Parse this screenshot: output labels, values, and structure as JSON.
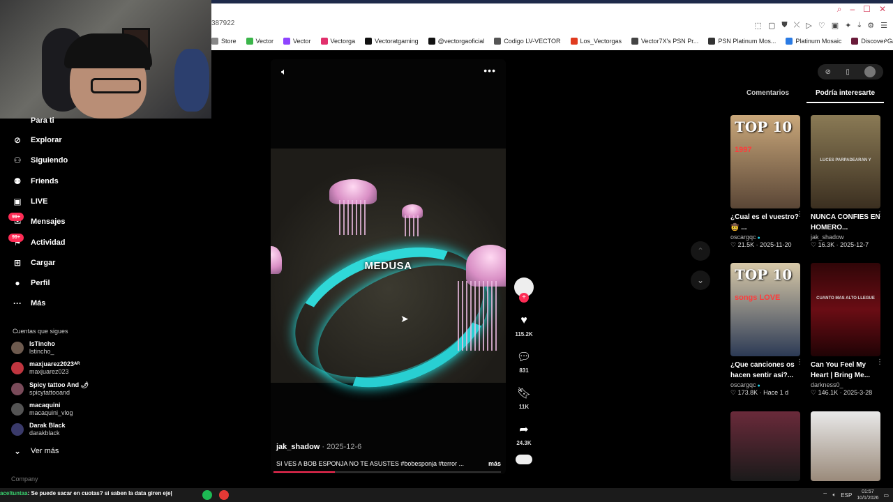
{
  "browser": {
    "address_fragment": "387922",
    "bookmarks": [
      {
        "label": "Store",
        "color": "#888888"
      },
      {
        "label": "Vector",
        "color": "#3bb54a"
      },
      {
        "label": "Vector",
        "color": "#8e44ff"
      },
      {
        "label": "Vectorga",
        "color": "#e1306c"
      },
      {
        "label": "Vectoratgaming",
        "color": "#111111"
      },
      {
        "label": "@vectorgaoficial",
        "color": "#111111"
      },
      {
        "label": "Codigo LV-VECTOR",
        "color": "#555555"
      },
      {
        "label": "Los_Vectorgas",
        "color": "#e03b1f"
      },
      {
        "label": "Vector7X's PSN Pr...",
        "color": "#444444"
      },
      {
        "label": "PSN Platinum Mos...",
        "color": "#333333"
      },
      {
        "label": "Platinum Mosaic",
        "color": "#2a7be4"
      },
      {
        "label": "Discover Games -...",
        "color": "#6a1b3a"
      }
    ]
  },
  "sidebar": {
    "top_partial": "Para ti",
    "items": [
      {
        "label": "Explorar",
        "icon": "compass-icon"
      },
      {
        "label": "Siguiendo",
        "icon": "following-icon"
      },
      {
        "label": "Friends",
        "icon": "friends-icon"
      },
      {
        "label": "LIVE",
        "icon": "live-icon"
      },
      {
        "label": "Mensajes",
        "icon": "messages-icon",
        "badge": "99+"
      },
      {
        "label": "Actividad",
        "icon": "activity-icon",
        "badge": "99+"
      },
      {
        "label": "Cargar",
        "icon": "upload-icon"
      },
      {
        "label": "Perfil",
        "icon": "profile-icon"
      },
      {
        "label": "Más",
        "icon": "more-icon"
      }
    ],
    "following_title": "Cuentas que sigues",
    "following": [
      {
        "name": "lsTincho",
        "handle": "lstincho_"
      },
      {
        "name": "maxjuarez2023ᴬᴿ",
        "handle": "maxjuarez023"
      },
      {
        "name": "Spicy tattoo And 🌶",
        "handle": "spicytattooand"
      },
      {
        "name": "macaquini",
        "handle": "macaquini_vlog"
      },
      {
        "name": "Darak Black",
        "handle": "darakblack"
      }
    ],
    "see_more": "Ver más",
    "company": "Company"
  },
  "video": {
    "overlay_text": "MEDUSA",
    "author": "jak_shadow",
    "date": "· 2025-12-6",
    "description": "SI VES A BOB ESPONJA NO TE ASUSTES #bobesponja #terror ...",
    "more": "más",
    "progress": 0.27
  },
  "actions": {
    "likes": "115.2K",
    "comments": "831",
    "saves": "11K",
    "shares": "24.3K"
  },
  "right_panel": {
    "tabs": [
      "Comentarios",
      "Podría interesarte"
    ],
    "active_tab": 1,
    "recommendations": [
      {
        "title": "¿Cual es el vuestro? 🤠 ...",
        "author": "oscargqc",
        "verified": true,
        "likes": "21.5K",
        "date": "2025-11-20",
        "thumb_text": "TOP 10",
        "thumb_sub": "1997"
      },
      {
        "title": "NUNCA CONFIES EN HOMERO...",
        "author": "jak_shadow",
        "verified": false,
        "likes": "16.3K",
        "date": "2025-12-7",
        "thumb_text": "",
        "thumb_sub": "LUCES PARPADEARAN Y"
      },
      {
        "title": "¿Que canciones os hacen sentir así?...",
        "author": "oscargqc",
        "verified": true,
        "likes": "173.8K",
        "date": "Hace 1 d",
        "thumb_text": "TOP 10",
        "thumb_sub": "songs LOVE"
      },
      {
        "title": "Can You Feel My Heart | Bring Me...",
        "author": "darkness0_",
        "verified": false,
        "likes": "146.1K",
        "date": "2025-3-28",
        "thumb_text": "",
        "thumb_sub": "CUANTO MAS ALTO LLEGUE"
      }
    ]
  },
  "taskbar": {
    "chat_user": "aceltuntaa",
    "chat_message": ": Se puede sacar en cuotas? si saben la data giren eje|",
    "lang": "ESP",
    "time": "01:57",
    "date": "10/1/2026"
  }
}
